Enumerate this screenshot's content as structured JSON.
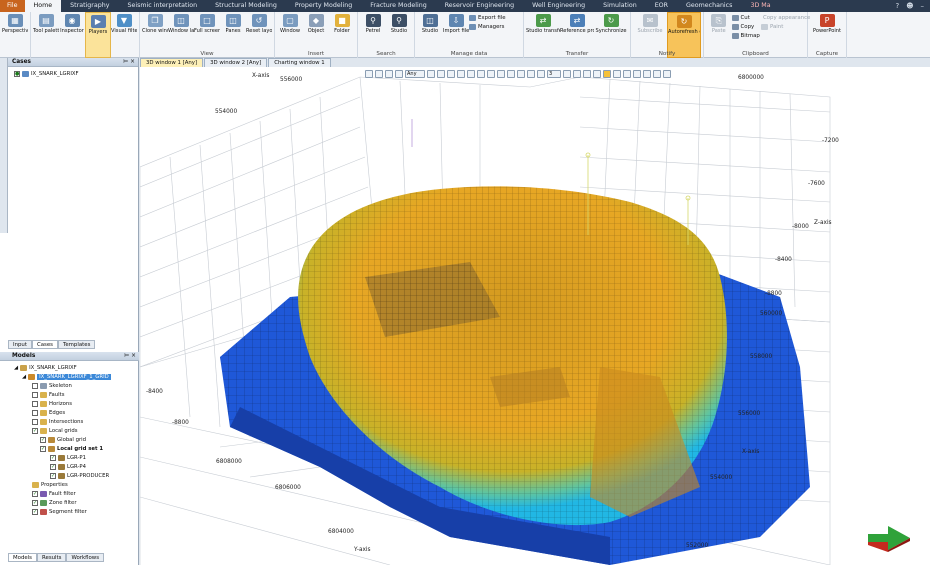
{
  "menu": {
    "tabs": [
      "File",
      "Home",
      "Stratigraphy",
      "Seismic interpretation",
      "Structural Modeling",
      "Property Modeling",
      "Fracture Modeling",
      "Reservoir Engineering",
      "Well Engineering",
      "Simulation",
      "EOR",
      "Geomechanics",
      "3D Ma"
    ]
  },
  "ribbon": {
    "groups": [
      {
        "label": "",
        "buttons": [
          "Perspective"
        ]
      },
      {
        "label": "",
        "buttons": [
          "Tool palette",
          "Inspector",
          "Players",
          "Visual filters"
        ]
      },
      {
        "label": "View",
        "buttons": [
          "Clone window",
          "Window layout",
          "Full screen",
          "Panes",
          "Reset layout"
        ]
      },
      {
        "label": "Insert",
        "buttons": [
          "Window",
          "Object",
          "Folder"
        ]
      },
      {
        "label": "Search",
        "buttons": [
          "Petrel",
          "Studio"
        ]
      },
      {
        "label": "Manage data",
        "buttons": [
          "Studio",
          "Import file"
        ],
        "small": [
          "Export file",
          "Managers"
        ]
      },
      {
        "label": "Transfer",
        "buttons": [
          "Studio transfer tool",
          "Reference project tool",
          "Synchronize"
        ]
      },
      {
        "label": "Notify",
        "buttons": [
          "Subscribe",
          "Autorefresh on/off"
        ]
      },
      {
        "label": "Clipboard",
        "buttons": [
          "Paste"
        ],
        "small": [
          "Cut",
          "Copy",
          "Bitmap"
        ],
        "small2": [
          "Copy appearance",
          "Paint"
        ]
      },
      {
        "label": "Capture",
        "buttons": [
          "PowerPoint"
        ]
      }
    ]
  },
  "cases": {
    "title": "Cases",
    "item": "IX_SNARK_LGRIXF"
  },
  "lefttabs": [
    "Input",
    "Cases",
    "Templates"
  ],
  "models": {
    "title": "Models",
    "root": "IX_SNARK_LGRIXF",
    "selected": "IX_SNARK_LGRIXF_1_GRID",
    "items": [
      "Skeleton",
      "Faults",
      "Horizons",
      "Edges",
      "Intersections",
      "Local grids",
      "Global grid",
      "Local grid set 1",
      "LGR-P1",
      "LGR-P4",
      "LGR-PRODUCER",
      "Properties",
      "Fault filter",
      "Zone filter",
      "Segment filter"
    ]
  },
  "bottomtabs": [
    "Models",
    "Results",
    "Workflows"
  ],
  "viewtabs": [
    "3D window 1 [Any]",
    "3D window 2 [Any]",
    "Charting window 1"
  ],
  "toolbar": {
    "filter": "Any",
    "num": "3"
  },
  "axes": {
    "xaxis_label": "X-axis",
    "yaxis_label": "Y-axis",
    "zaxis_label": "Z-axis",
    "x_top": [
      "556000",
      "554000"
    ],
    "y_right_top": "6800000",
    "z_right": [
      "-7200",
      "-7600",
      "-8000",
      "-8400",
      "-8800"
    ],
    "x_right": [
      "560000",
      "558000",
      "556000",
      "554000",
      "552000"
    ],
    "z_left": [
      "-8400",
      "-8800"
    ],
    "y_bottom": [
      "6808000",
      "6806000",
      "6804000"
    ]
  },
  "colors": {
    "ribbon_bg": "#f3f5f8",
    "menubar": "#2b3a4f",
    "grid_orange": "#e8a020",
    "grid_blue": "#1e5ad6",
    "accent": "#f7c35a"
  }
}
